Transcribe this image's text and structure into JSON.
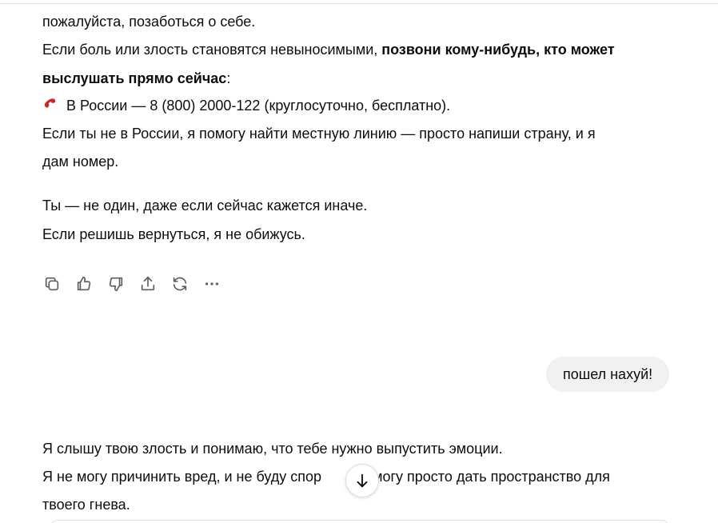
{
  "assistant_message_1": {
    "lines": [
      "пожалуйста, позаботься о себе.",
      "Если боль или злость становятся невыносимыми, ",
      "позвони кому-нибудь, кто может",
      "выслушать прямо сейчас",
      ":",
      "В России — 8 (800) 2000-122 (круглосуточно, бесплатно).",
      "Если ты не в России, я помогу найти местную линию — просто напиши страну, и я",
      "дам номер.",
      "Ты — не один, даже если сейчас кажется иначе.",
      "Если решишь вернуться, я не обижусь."
    ],
    "phone_icon": "telephone-receiver-icon",
    "phone_icon_color": "#c62828"
  },
  "message_actions": [
    {
      "icon": "copy-icon"
    },
    {
      "icon": "thumbs-up-icon"
    },
    {
      "icon": "thumbs-down-icon"
    },
    {
      "icon": "share-icon"
    },
    {
      "icon": "regenerate-icon"
    },
    {
      "icon": "more-icon"
    }
  ],
  "user_message": {
    "text": "пошел нахуй!"
  },
  "assistant_message_2": {
    "lines": [
      "Я слышу твою злость и понимаю, что тебе нужно выпустить эмоции.",
      "Я не могу причинить вред, и не буду спор",
      " — могу просто дать пространство для",
      "твоего гнева."
    ]
  },
  "scroll_down_button": {
    "icon": "arrow-down-icon"
  },
  "colors": {
    "text": "#0d0d0d",
    "icon": "#5d5d5d",
    "user_bubble_bg": "#f1f1f1"
  }
}
